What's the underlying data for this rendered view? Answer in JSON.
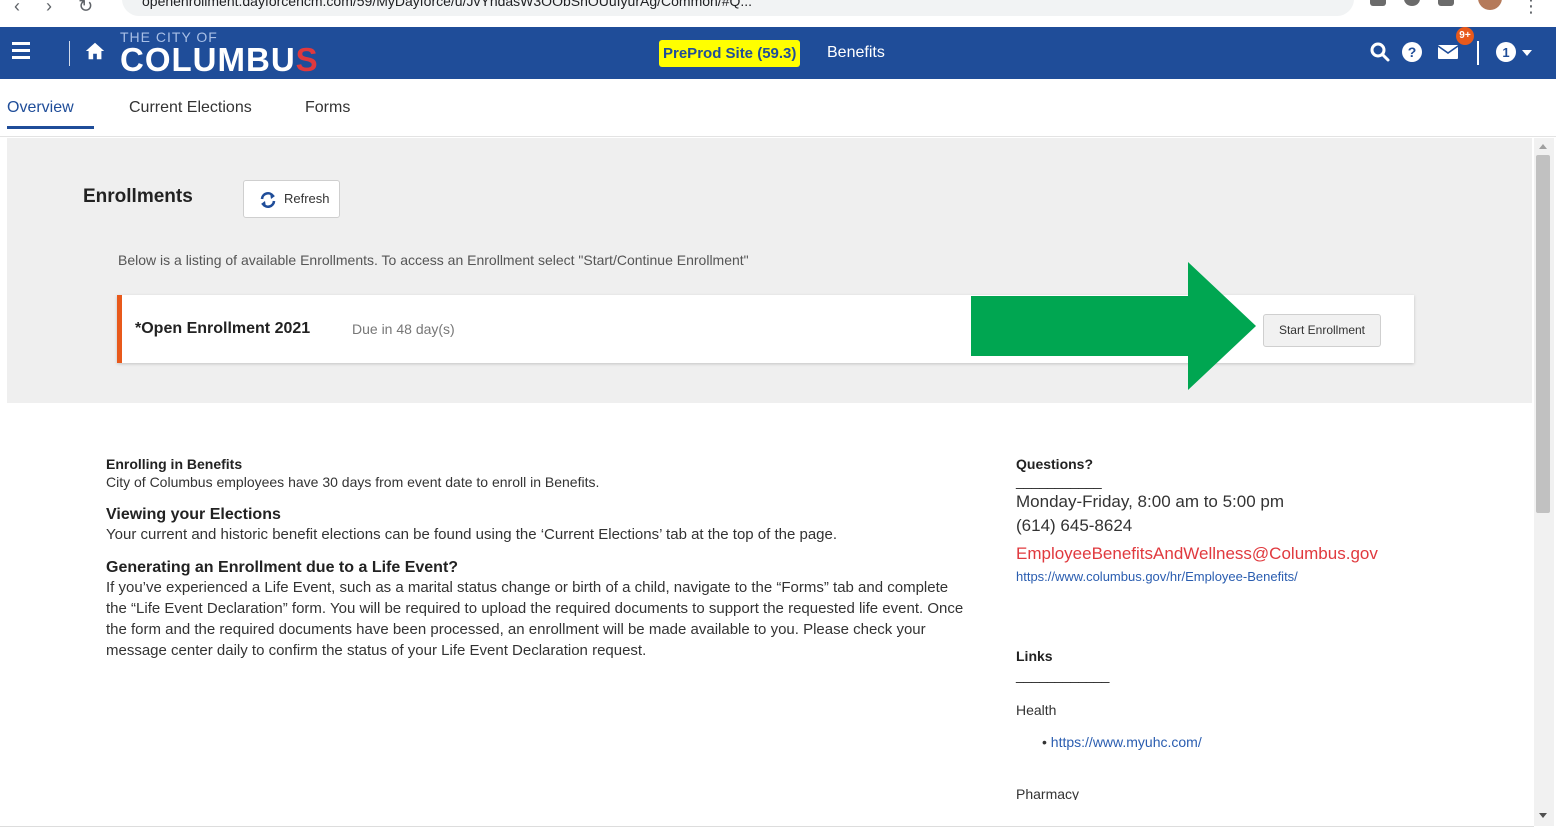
{
  "browser": {
    "address_text": "openenrollment.dayforcehcm.com/59/MyDayforce/u/JvYhdasW3OObSnOUuIyurAg/Common/#Q..."
  },
  "header": {
    "logo_small": "THE CITY OF",
    "logo_main": "COLUMB",
    "logo_u": "U",
    "logo_s": "S",
    "env_badge": "PreProd Site (59.3)",
    "page_name": "Benefits",
    "mail_badge": "9+",
    "colors": {
      "bar": "#1f4d99",
      "badge": "#ffff00",
      "accent": "#e8591b"
    }
  },
  "tabs": [
    {
      "label": "Overview",
      "active": true
    },
    {
      "label": "Current Elections",
      "active": false
    },
    {
      "label": "Forms",
      "active": false
    }
  ],
  "enrollments": {
    "title": "Enrollments",
    "refresh_label": "Refresh",
    "intro": "Below is a listing of available Enrollments. To access an Enrollment select \"Start/Continue Enrollment\"",
    "item": {
      "title": "*Open Enrollment 2021",
      "due": "Due in 48 day(s)",
      "action_label": "Start Enrollment"
    }
  },
  "info": {
    "s1_title": "Enrolling in Benefits",
    "s1_text": "City of Columbus employees have 30 days from event date to enroll in Benefits.",
    "s2_title": "Viewing your Elections",
    "s2_text": "Your current and historic benefit elections can be found using the ‘Current Elections’ tab at the top of the page.",
    "s3_title": "Generating an Enrollment due to a Life Event?",
    "s3_text": "If you’ve experienced a Life Event, such as a marital status change or birth of a child, navigate to the “Forms” tab and complete the “Life Event Declaration” form.  You will be required to upload the required documents to support the requested life event. Once the form and the required documents have been processed, an enrollment will be made available to you. Please check your message center daily to confirm the status of your Life Event Declaration request."
  },
  "questions": {
    "title": "Questions?",
    "underline": "___________",
    "hours": "Monday-Friday,  8:00 am to 5:00 pm",
    "phone": "(614) 645-8624",
    "email": "EmployeeBenefitsAndWellness@Columbus.gov",
    "url": "https://www.columbus.gov/hr/Employee-Benefits/"
  },
  "links": {
    "title": "Links",
    "underline": "____________",
    "health_label": "Health",
    "health_url": "https://www.myuhc.com/",
    "next_label": "Pharmacy"
  }
}
